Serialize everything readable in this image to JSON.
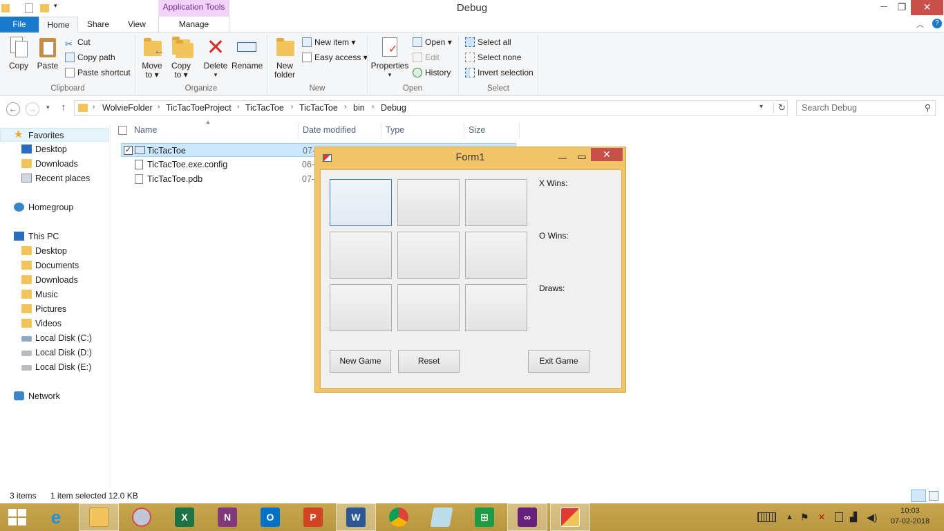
{
  "window": {
    "title": "Debug",
    "context_tab": "Application Tools",
    "controls": {
      "minimize": "—",
      "maximize": "❐",
      "close": "✕"
    }
  },
  "ribbon_tabs": [
    "File",
    "Home",
    "Share",
    "View",
    "Manage"
  ],
  "ribbon": {
    "clipboard": {
      "label": "Clipboard",
      "copy": "Copy",
      "paste": "Paste",
      "cut": "Cut",
      "copy_path": "Copy path",
      "paste_shortcut": "Paste shortcut"
    },
    "organize": {
      "label": "Organize",
      "move_to": "Move",
      "move_to2": "to ▾",
      "copy_to": "Copy",
      "copy_to2": "to ▾",
      "delete": "Delete",
      "delete2": "▾",
      "rename": "Rename"
    },
    "new": {
      "label": "New",
      "new_folder": "New",
      "new_folder2": "folder",
      "new_item": "New item ▾",
      "easy_access": "Easy access ▾"
    },
    "open": {
      "label": "Open",
      "properties": "Properties",
      "properties2": "▾",
      "open": "Open ▾",
      "edit": "Edit",
      "history": "History"
    },
    "select": {
      "label": "Select",
      "select_all": "Select all",
      "select_none": "Select none",
      "invert": "Invert selection"
    }
  },
  "address": {
    "crumbs": [
      "WolvieFolder",
      "TicTacToeProject",
      "TicTacToe",
      "TicTacToe",
      "bin",
      "Debug"
    ],
    "search_placeholder": "Search Debug"
  },
  "nav": {
    "favorites": "Favorites",
    "fav_items": [
      "Desktop",
      "Downloads",
      "Recent places"
    ],
    "homegroup": "Homegroup",
    "this_pc": "This PC",
    "pc_items": [
      "Desktop",
      "Documents",
      "Downloads",
      "Music",
      "Pictures",
      "Videos",
      "Local Disk (C:)",
      "Local Disk (D:)",
      "Local Disk (E:)"
    ],
    "network": "Network"
  },
  "columns": [
    "Name",
    "Date modified",
    "Type",
    "Size"
  ],
  "files": [
    {
      "name": "TicTacToe",
      "date": "07-"
    },
    {
      "name": "TicTacToe.exe.config",
      "date": "06-"
    },
    {
      "name": "TicTacToe.pdb",
      "date": "07-"
    }
  ],
  "status": {
    "items": "3 items",
    "selected": "1 item selected",
    "size": "12.0 KB"
  },
  "form1": {
    "title": "Form1",
    "x_wins": "X Wins:",
    "o_wins": "O Wins:",
    "draws": "Draws:",
    "new_game": "New Game",
    "reset": "Reset",
    "exit_game": "Exit Game"
  },
  "taskbar": {
    "time": "10:03",
    "date": "07-02-2018",
    "apps": [
      "Internet Explorer",
      "File Explorer",
      "Skype",
      "Excel",
      "OneNote",
      "Outlook",
      "PowerPoint",
      "Word",
      "Chrome",
      "Notepad",
      "Excel Online",
      "Visual Studio",
      "Form1"
    ]
  },
  "colors": {
    "file_tab": "#1979ca",
    "form_frame": "#f2c46a",
    "close_red": "#c7504a",
    "taskbar": "#c0a04a"
  }
}
